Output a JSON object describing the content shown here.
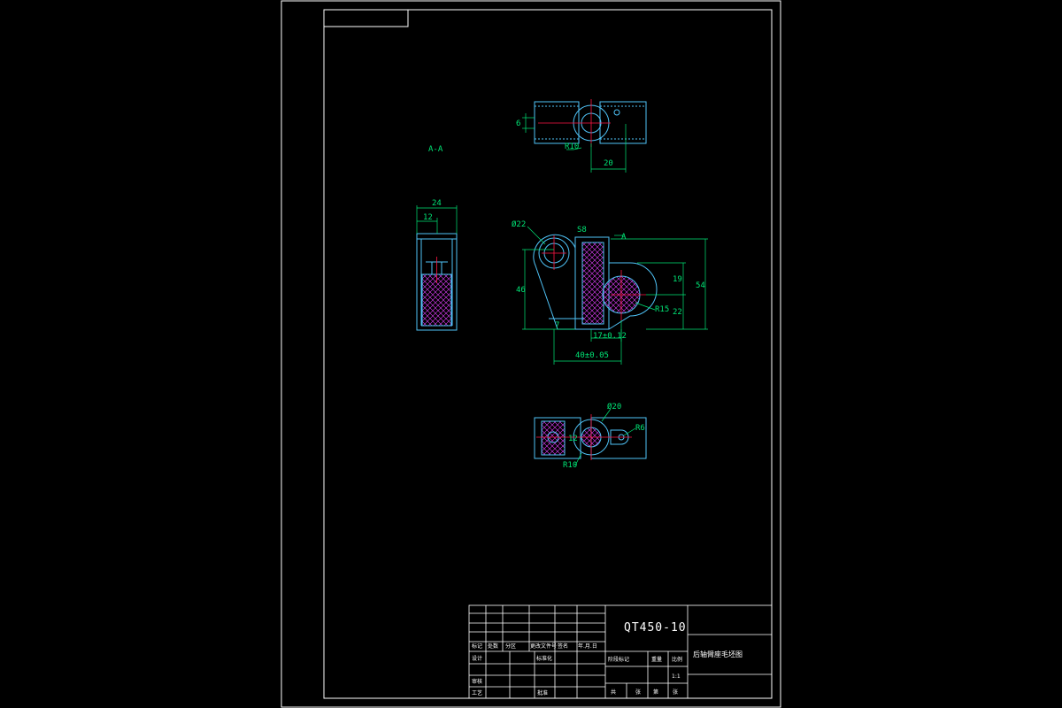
{
  "drawing": {
    "section_label": "A-A",
    "section_marker": "A",
    "material": "QT450-10",
    "part_name": "后轴臂座毛坯图",
    "scale": "1:1"
  },
  "dimensions": {
    "top_view": {
      "d6": "6",
      "r10": "R10",
      "d20": "20"
    },
    "side_view": {
      "d24": "24",
      "d12": "12"
    },
    "front_view": {
      "phi22": "Ø22",
      "s8": "S8",
      "d46": "46",
      "d7": "7",
      "d19": "19",
      "d54": "54",
      "d22": "22",
      "r15": "R15",
      "tol1": "17±0.12",
      "tol2": "40±0.05"
    },
    "bottom_view": {
      "phi20": "Ø20",
      "d12": "12",
      "r6": "R6",
      "r10": "R10"
    }
  },
  "title_block": {
    "labels": {
      "biaoji": "标记",
      "chushu": "处数",
      "fenqu": "分区",
      "gengwen": "更改文件号",
      "qianming": "签名",
      "riqi": "年.月.日",
      "sheji": "设计",
      "biaozhunhua": "标准化",
      "shenhe": "审核",
      "gongyi": "工艺",
      "pizhun": "批准",
      "jieduan": "阶段标记",
      "zhongliang": "重量",
      "bili": "比例",
      "gong": "共",
      "zhang": "张",
      "di": "第"
    }
  }
}
